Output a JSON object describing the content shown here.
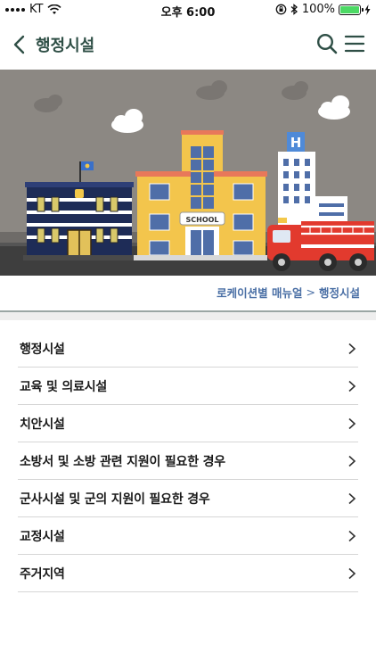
{
  "status_bar": {
    "carrier": "KT",
    "time": "오후 6:00",
    "battery": "100%",
    "battery_level": 1.0
  },
  "nav": {
    "title": "행정시설"
  },
  "banner": {
    "sign_text": "SCHOOL",
    "hospital_letter": "H"
  },
  "breadcrumb": {
    "parent": "로케이션별 매뉴얼",
    "separator": ">",
    "current": "행정시설"
  },
  "list": {
    "items": [
      {
        "label": "행정시설"
      },
      {
        "label": "교육 및 의료시설"
      },
      {
        "label": "치안시설"
      },
      {
        "label": "소방서 및 소방 관련 지원이 필요한 경우"
      },
      {
        "label": "군사시설 및 군의 지원이 필요한 경우"
      },
      {
        "label": "교정시설"
      },
      {
        "label": "주거지역"
      }
    ]
  },
  "colors": {
    "accent": "#2f4f46",
    "breadcrumb": "#4a6fa5",
    "banner_sky": "#8c8883",
    "battery": "#4cd964"
  }
}
